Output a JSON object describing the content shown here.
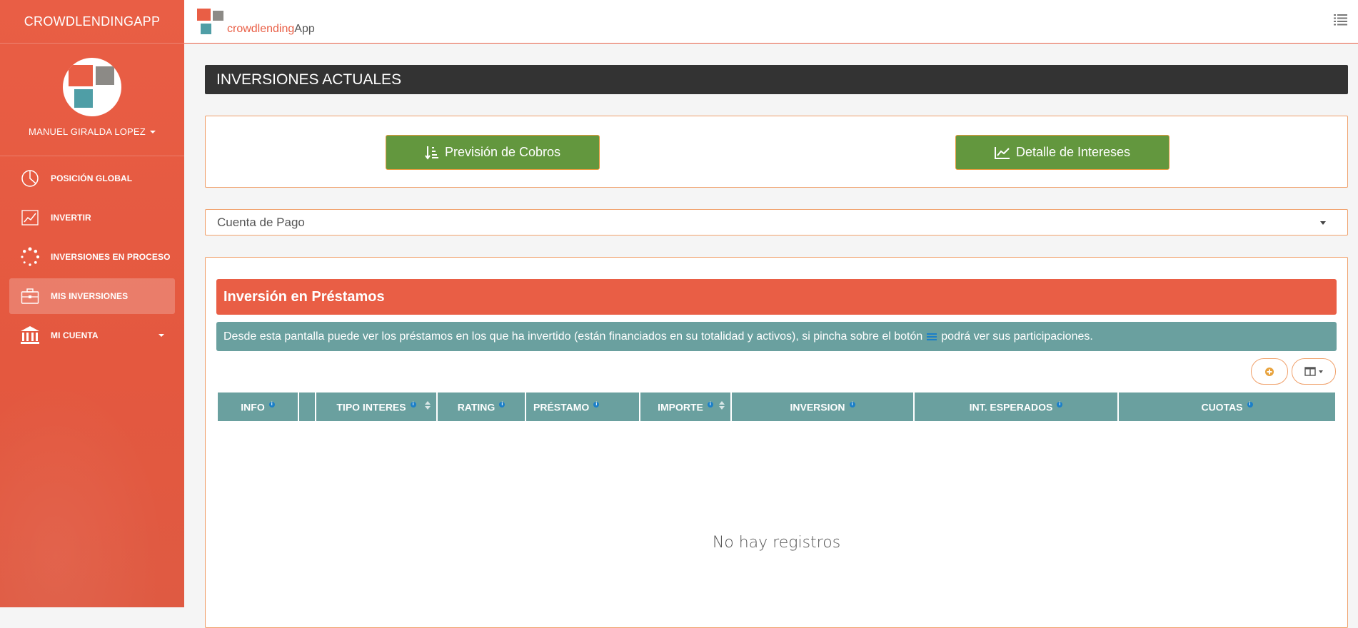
{
  "sidebar": {
    "brand": "CROWDLENDINGAPP",
    "user_name": "MANUEL GIRALDA LOPEZ",
    "items": [
      {
        "label": "POSICIÓN GLOBAL",
        "icon": "pie-chart-icon"
      },
      {
        "label": "INVERTIR",
        "icon": "line-chart-icon"
      },
      {
        "label": "INVERSIONES EN PROCESO",
        "icon": "spinner-icon"
      },
      {
        "label": "MIS INVERSIONES",
        "icon": "briefcase-icon",
        "active": true
      },
      {
        "label": "MI CUENTA",
        "icon": "bank-icon",
        "has_caret": true
      }
    ]
  },
  "topbar": {
    "logo_crowd": "crowdlending",
    "logo_app": "App"
  },
  "main": {
    "page_title": "INVERSIONES ACTUALES",
    "buttons": {
      "prevision": "Previsión de Cobros",
      "detalle": "Detalle de Intereses"
    },
    "select": {
      "value": "Cuenta de Pago"
    },
    "card": {
      "title": "Inversión en Préstamos",
      "info_before": "Desde esta pantalla puede ver los préstamos en los que ha invertido (están financiados en su totalidad y activos), si pincha sobre el botón",
      "info_after": "podrá ver sus participaciones.",
      "columns": [
        {
          "label": "INFO",
          "info": true,
          "sortable": false
        },
        {
          "label": "",
          "info": false,
          "sortable": false
        },
        {
          "label": "TIPO INTERES",
          "info": true,
          "sortable": true
        },
        {
          "label": "RATING",
          "info": true,
          "sortable": false
        },
        {
          "label": "PRÉSTAMO",
          "info": true,
          "sortable": false
        },
        {
          "label": "IMPORTE",
          "info": true,
          "sortable": true
        },
        {
          "label": "INVERSION",
          "info": true,
          "sortable": false
        },
        {
          "label": "INT. ESPERADOS",
          "info": true,
          "sortable": false
        },
        {
          "label": "CUOTAS",
          "info": true,
          "sortable": false
        }
      ],
      "empty_text": "No hay registros"
    }
  },
  "colors": {
    "accent": "#e95e45",
    "teal": "#6aa09f",
    "green": "#63973e",
    "dark": "#333333",
    "border": "#f0a06a"
  }
}
